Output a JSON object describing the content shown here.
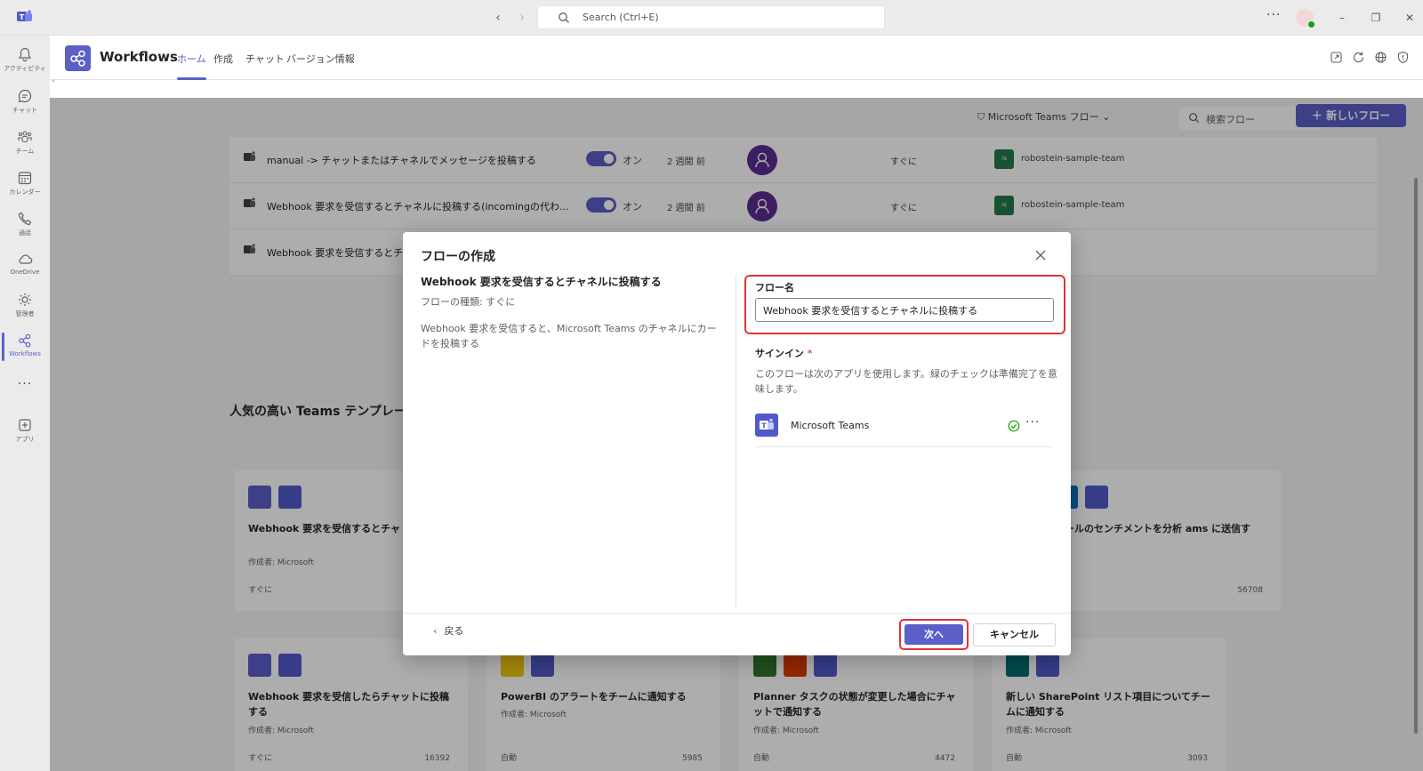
{
  "titlebar": {
    "search_placeholder": "Search (Ctrl+E)",
    "more_label": "···"
  },
  "rail": {
    "items": [
      {
        "label": "アクティビティ",
        "icon": "bell-icon"
      },
      {
        "label": "チャット",
        "icon": "chat-icon"
      },
      {
        "label": "チーム",
        "icon": "teams-icon"
      },
      {
        "label": "カレンダー",
        "icon": "calendar-icon"
      },
      {
        "label": "通話",
        "icon": "phone-icon"
      },
      {
        "label": "OneDrive",
        "icon": "cloud-icon"
      },
      {
        "label": "管理者",
        "icon": "admin-icon"
      },
      {
        "label": "Workflows",
        "icon": "workflows-icon"
      },
      {
        "label": "アプリ",
        "icon": "apps-icon"
      }
    ],
    "more_label": "···"
  },
  "app": {
    "title": "Workflows",
    "tabs": [
      {
        "label": "ホーム",
        "active": true
      },
      {
        "label": "作成",
        "active": false
      },
      {
        "label": "チャット",
        "active": false
      },
      {
        "label": "バージョン情報",
        "active": false
      }
    ],
    "sub_strip_text": "`"
  },
  "main": {
    "filter_label": "Microsoft Teams フロー",
    "search_placeholder": "検索フロー",
    "new_flow_label": "新しいフロー",
    "flows": [
      {
        "name": "manual -> チャットまたはチャネルでメッセージを投稿する",
        "status": "オン",
        "modified": "2 週間 前",
        "type": "すぐに",
        "team": "robostein-sample-team"
      },
      {
        "name": "Webhook 要求を受信するとチャネルに投稿する(incomingの代わ...",
        "status": "オン",
        "modified": "2 週間 前",
        "type": "すぐに",
        "team": "robostein-sample-team"
      },
      {
        "name": "Webhook 要求を受信するとチ",
        "status": "",
        "modified": "",
        "type": "",
        "team": ""
      }
    ],
    "popular_heading": "人気の高い Teams テンプレー",
    "templates_row1": [
      {
        "title": "Webhook 要求を受信するとチャ する",
        "by": "作成者: Microsoft",
        "kind": "すぐに",
        "count": ""
      },
      {
        "title": "メールのセンチメントを分析 ams に送信する",
        "by": "ft",
        "kind": "",
        "count": "56708"
      }
    ],
    "templates_row2": [
      {
        "title": "Webhook 要求を受信したらチャットに投稿する",
        "by": "作成者: Microsoft",
        "kind": "すぐに",
        "count": "16392"
      },
      {
        "title": "PowerBI のアラートをチームに通知する",
        "by": "作成者: Microsoft",
        "kind": "自動",
        "count": "5985"
      },
      {
        "title": "Planner タスクの状態が変更した場合にチャットで通知する",
        "by": "作成者: Microsoft",
        "kind": "自動",
        "count": "4472"
      },
      {
        "title": "新しい SharePoint リスト項目についてチームに通知する",
        "by": "作成者: Microsoft",
        "kind": "自動",
        "count": "3093"
      }
    ]
  },
  "dialog": {
    "title": "フローの作成",
    "template_title": "Webhook 要求を受信するとチャネルに投稿する",
    "template_type": "フローの種類: すぐに",
    "template_desc": "Webhook 要求を受信すると、Microsoft Teams のチャネルにカードを投稿する",
    "flow_name_label": "フロー名",
    "flow_name_value": "Webhook 要求を受信するとチャネルに投稿する",
    "signin_label": "サインイン",
    "signin_required": "*",
    "signin_desc": "このフローは次のアプリを使用します。緑のチェックは準備完了を意味します。",
    "connection_name": "Microsoft Teams",
    "connection_more": "···",
    "back_label": "戻る",
    "next_label": "次へ",
    "cancel_label": "キャンセル"
  },
  "colors": {
    "brand": "#5b5fc7",
    "highlight": "#e23434",
    "success": "#13a10e"
  }
}
